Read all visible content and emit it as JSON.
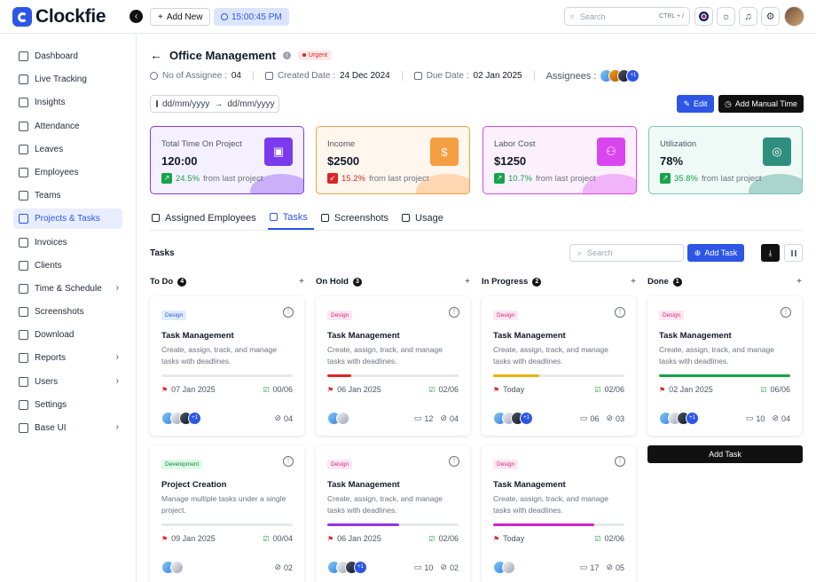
{
  "app": {
    "brand": "Clockfie",
    "add_new": "Add New",
    "timer": "15:00:45 PM",
    "search_placeholder": "Search",
    "search_shortcut": "CTRL + /"
  },
  "sidebar": {
    "items": [
      {
        "label": "Dashboard",
        "icon": "dashboard-icon"
      },
      {
        "label": "Live Tracking",
        "icon": "live-tracking-icon"
      },
      {
        "label": "Insights",
        "icon": "insights-icon"
      },
      {
        "label": "Attendance",
        "icon": "attendance-icon"
      },
      {
        "label": "Leaves",
        "icon": "leaves-icon"
      },
      {
        "label": "Employees",
        "icon": "employees-icon"
      },
      {
        "label": "Teams",
        "icon": "teams-icon"
      },
      {
        "label": "Projects & Tasks",
        "icon": "projects-icon",
        "active": true
      },
      {
        "label": "Invoices",
        "icon": "invoices-icon"
      },
      {
        "label": "Clients",
        "icon": "clients-icon"
      },
      {
        "label": "Time & Schedule",
        "icon": "schedule-icon",
        "chevron": true
      },
      {
        "label": "Screenshots",
        "icon": "screenshots-icon"
      },
      {
        "label": "Download",
        "icon": "download-icon"
      },
      {
        "label": "Reports",
        "icon": "reports-icon",
        "chevron": true
      },
      {
        "label": "Users",
        "icon": "users-icon",
        "chevron": true
      },
      {
        "label": "Settings",
        "icon": "settings-icon"
      },
      {
        "label": "Base UI",
        "icon": "base-ui-icon",
        "chevron": true
      }
    ]
  },
  "project": {
    "title": "Office Management",
    "priority": "Urgent",
    "assignee_label": "No of Assignee :",
    "assignee_count": "04",
    "created_label": "Created Date :",
    "created_value": "24 Dec 2024",
    "due_label": "Due Date :",
    "due_value": "02 Jan 2025",
    "assignees_label": "Assignees :",
    "assignees_more": "+1"
  },
  "date_range": {
    "from": "dd/mm/yyyy",
    "to": "dd/mm/yyyy"
  },
  "actions": {
    "edit": "Edit",
    "manual_time": "Add Manual Time"
  },
  "stats": [
    {
      "label": "Total Time On Project",
      "value": "120:00",
      "pct": "24.5%",
      "trend": "up",
      "suffix": "from last project",
      "accent": "#7c3aed"
    },
    {
      "label": "Income",
      "value": "$2500",
      "pct": "15.2%",
      "trend": "down",
      "suffix": "from last project",
      "accent": "#f59e42"
    },
    {
      "label": "Labor Cost",
      "value": "$1250",
      "pct": "10.7%",
      "trend": "up",
      "suffix": "from last project",
      "accent": "#d946ef"
    },
    {
      "label": "Utilization",
      "value": "78%",
      "pct": "35.8%",
      "trend": "up",
      "suffix": "from last project",
      "accent": "#2f8f7f"
    }
  ],
  "tabs": [
    {
      "label": "Assigned Employees",
      "icon": "user-icon"
    },
    {
      "label": "Tasks",
      "icon": "tasks-icon",
      "active": true
    },
    {
      "label": "Screenshots",
      "icon": "image-icon"
    },
    {
      "label": "Usage",
      "icon": "pie-icon"
    }
  ],
  "tasks": {
    "heading": "Tasks",
    "search_placeholder": "Search",
    "add_task": "Add Task",
    "done_add_task": "Add Task"
  },
  "columns": [
    {
      "name": "To Do",
      "count": "4",
      "cards": [
        {
          "tag": "Design",
          "tag_style": "design-blue",
          "title": "Task Management",
          "desc": "Create, assign, track, and manage tasks with deadlines.",
          "progress": 0,
          "progress_color": "#e5e7eb",
          "date": "07 Jan 2025",
          "checks": "00/06",
          "comments": "",
          "files": "04",
          "avatars_more": "+1"
        },
        {
          "tag": "Development",
          "tag_style": "dev",
          "title": "Project Creation",
          "desc": "Manage multiple tasks under a single project.",
          "progress": 0,
          "progress_color": "#e5e7eb",
          "date": "09 Jan 2025",
          "checks": "00/04",
          "comments": "",
          "files": "02",
          "avatars_more": ""
        }
      ]
    },
    {
      "name": "On Hold",
      "count": "3",
      "cards": [
        {
          "tag": "Design",
          "tag_style": "design-pink",
          "title": "Task Management",
          "desc": "Create, assign, track, and manage tasks with deadlines.",
          "progress": 0.18,
          "progress_color": "#dc2626",
          "date": "06 Jan 2025",
          "checks": "02/06",
          "comments": "12",
          "files": "04",
          "avatars_more": ""
        },
        {
          "tag": "Design",
          "tag_style": "design-pink",
          "title": "Task Management",
          "desc": "Create, assign, track, and manage tasks with deadlines.",
          "progress": 0.55,
          "progress_color": "#9333ea",
          "date": "06 Jan 2025",
          "checks": "02/06",
          "comments": "10",
          "files": "02",
          "avatars_more": "+1"
        }
      ]
    },
    {
      "name": "In Progress",
      "count": "2",
      "cards": [
        {
          "tag": "Design",
          "tag_style": "design-pink",
          "title": "Task Management",
          "desc": "Create, assign, track, and manage tasks with deadlines.",
          "progress": 0.35,
          "progress_color": "#eab308",
          "date": "Today",
          "checks": "02/06",
          "comments": "06",
          "files": "03",
          "avatars_more": "+1"
        },
        {
          "tag": "Design",
          "tag_style": "design-pink",
          "title": "Task Management",
          "desc": "Create, assign, track, and manage tasks with deadlines.",
          "progress": 0.77,
          "progress_color": "#d91ecf",
          "date": "Today",
          "checks": "02/06",
          "comments": "17",
          "files": "05",
          "avatars_more": ""
        }
      ]
    },
    {
      "name": "Done",
      "count": "1",
      "cards": [
        {
          "tag": "Design",
          "tag_style": "design-pink",
          "title": "Task Management",
          "desc": "Create, assign, track, and manage tasks with deadlines.",
          "progress": 1,
          "progress_color": "#16a34a",
          "date": "02 Jan 2025",
          "checks": "06/06",
          "comments": "10",
          "files": "04",
          "avatars_more": "+1"
        }
      ]
    }
  ]
}
